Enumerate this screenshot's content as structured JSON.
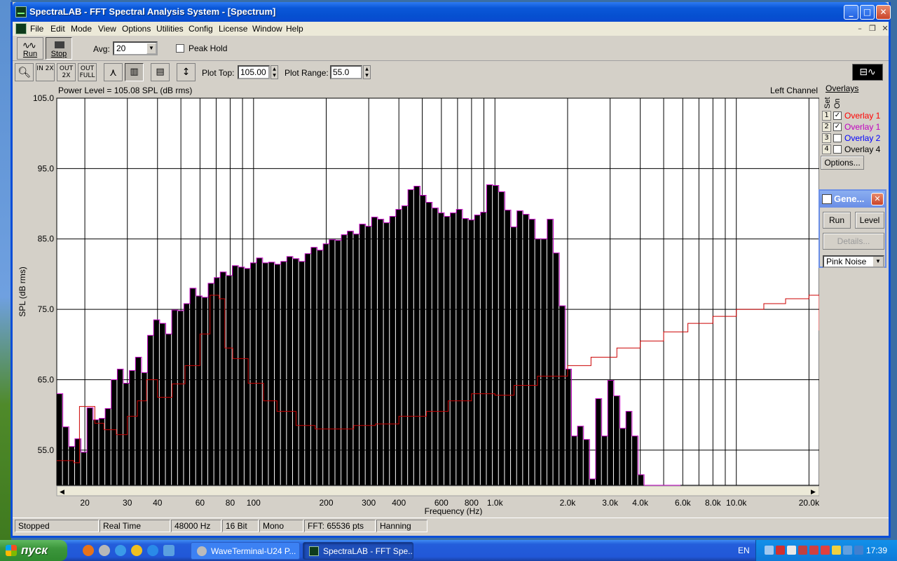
{
  "window": {
    "title": "SpectraLAB - FFT Spectral Analysis System - [Spectrum]"
  },
  "menu": [
    "File",
    "Edit",
    "Mode",
    "View",
    "Options",
    "Utilities",
    "Config",
    "License",
    "Window",
    "Help"
  ],
  "toolbar": {
    "run_label": "Run",
    "stop_label": "Stop",
    "avg_label": "Avg:",
    "avg_value": "20",
    "peak_hold_label": "Peak Hold",
    "peak_hold_checked": false,
    "zoom_in_label": "IN 2X",
    "zoom_out_label": "OUT 2X",
    "zoom_full_label": "OUT FULL",
    "plot_top_label": "Plot Top:",
    "plot_top_value": "105.00",
    "plot_range_label": "Plot Range:",
    "plot_range_value": "55.0"
  },
  "plot": {
    "power_level": "Power Level = 105.08 SPL (dB rms)",
    "channel": "Left Channel"
  },
  "overlays": {
    "header": "Overlays",
    "set_label": "Set",
    "on_label": "On",
    "items": [
      {
        "num": "1",
        "name": "Overlay 1",
        "checked": true,
        "color": "#ff0000"
      },
      {
        "num": "2",
        "name": "Overlay 1",
        "checked": true,
        "color": "#c000c0"
      },
      {
        "num": "3",
        "name": "Overlay 2",
        "checked": false,
        "color": "#0000ff"
      },
      {
        "num": "4",
        "name": "Overlay 4",
        "checked": false,
        "color": "#000000"
      }
    ],
    "options_label": "Options..."
  },
  "generator": {
    "title": "Gene...",
    "run_label": "Run",
    "level_label": "Level",
    "details_label": "Details...",
    "signal": "Pink Noise"
  },
  "status": [
    "Stopped",
    "Real Time",
    "48000 Hz",
    "16 Bit",
    "Mono",
    "FFT: 65536 pts",
    "Hanning"
  ],
  "taskbar": {
    "start_label": "пуск",
    "tasks": [
      "WaveTerminal-U24 P...",
      "SpectraLAB - FFT Spe..."
    ],
    "lang": "EN",
    "clock": "17:39"
  },
  "chart_data": {
    "type": "bar",
    "xlabel": "Frequency (Hz)",
    "ylabel": "SPL (dB rms)",
    "xscale": "log",
    "xlim": [
      15.3,
      22050
    ],
    "ylim": [
      50,
      105
    ],
    "yticks": [
      55.0,
      65.0,
      75.0,
      85.0,
      95.0,
      105.0
    ],
    "xtick_labels": [
      {
        "f": 20,
        "label": "20"
      },
      {
        "f": 30,
        "label": "30"
      },
      {
        "f": 40,
        "label": "40"
      },
      {
        "f": 60,
        "label": "60"
      },
      {
        "f": 80,
        "label": "80"
      },
      {
        "f": 100,
        "label": "100"
      },
      {
        "f": 200,
        "label": "200"
      },
      {
        "f": 300,
        "label": "300"
      },
      {
        "f": 400,
        "label": "400"
      },
      {
        "f": 600,
        "label": "600"
      },
      {
        "f": 800,
        "label": "800"
      },
      {
        "f": 1000,
        "label": "1.0k"
      },
      {
        "f": 2000,
        "label": "2.0k"
      },
      {
        "f": 3000,
        "label": "3.0k"
      },
      {
        "f": 4000,
        "label": "4.0k"
      },
      {
        "f": 6000,
        "label": "6.0k"
      },
      {
        "f": 8000,
        "label": "8.0k"
      },
      {
        "f": 10000,
        "label": "10.0k"
      },
      {
        "f": 20000,
        "label": "20.0k"
      }
    ],
    "grid_freqs": [
      20,
      30,
      40,
      50,
      60,
      70,
      80,
      90,
      100,
      200,
      300,
      400,
      500,
      600,
      700,
      800,
      900,
      1000,
      2000,
      3000,
      4000,
      5000,
      6000,
      7000,
      8000,
      9000,
      10000,
      20000
    ],
    "band_resolution": "1/12 octave",
    "bands_start_hz": 15.3,
    "bar_values": [
      63.0,
      58.3,
      55.5,
      56.6,
      54.7,
      61.0,
      59.3,
      59.5,
      60.9,
      65.0,
      66.5,
      64.5,
      66.3,
      68.2,
      66.0,
      71.3,
      73.5,
      73.0,
      71.5,
      74.9,
      74.8,
      75.8,
      78.0,
      76.9,
      76.7,
      78.7,
      79.5,
      80.3,
      79.8,
      81.2,
      81.0,
      80.8,
      81.6,
      82.3,
      81.6,
      81.7,
      81.4,
      81.8,
      82.5,
      82.2,
      81.8,
      82.9,
      83.8,
      83.4,
      84.3,
      84.9,
      84.8,
      85.6,
      86.1,
      85.7,
      87.1,
      86.8,
      88.1,
      87.8,
      87.3,
      88.2,
      89.2,
      89.7,
      92.0,
      92.5,
      91.2,
      90.2,
      89.4,
      88.7,
      88.2,
      88.7,
      89.2,
      87.9,
      87.7,
      88.4,
      88.8,
      92.7,
      92.6,
      91.7,
      89.1,
      86.7,
      89.0,
      88.5,
      87.8,
      85.0,
      85.0,
      87.8,
      83.0,
      75.5,
      66.5,
      57.0,
      58.4,
      56.5,
      50.9,
      62.3,
      57.0,
      64.9,
      62.7,
      58.1,
      60.5,
      57.0,
      51.5,
      50.0,
      50.0,
      50.0,
      50.0,
      50.0,
      50.0
    ],
    "series": [
      {
        "name": "Overlay 1",
        "color": "#cc0000",
        "points": [
          [
            15.3,
            53.5
          ],
          [
            18.0,
            53.2
          ],
          [
            19.0,
            61.2
          ],
          [
            22.0,
            58.8
          ],
          [
            24.0,
            57.9
          ],
          [
            27.0,
            57.2
          ],
          [
            30.0,
            59.8
          ],
          [
            33.0,
            62.0
          ],
          [
            36.0,
            65.0
          ],
          [
            40.0,
            62.5
          ],
          [
            46.0,
            64.4
          ],
          [
            52.0,
            67.0
          ],
          [
            60.0,
            71.5
          ],
          [
            66.0,
            77.0
          ],
          [
            72.0,
            76.5
          ],
          [
            76.0,
            69.5
          ],
          [
            82.0,
            68.0
          ],
          [
            95.0,
            64.5
          ],
          [
            110.0,
            62.0
          ],
          [
            125.0,
            60.5
          ],
          [
            150.0,
            58.5
          ],
          [
            180.0,
            58.0
          ],
          [
            220.0,
            58.0
          ],
          [
            260.0,
            58.5
          ],
          [
            320.0,
            58.7
          ],
          [
            400.0,
            59.8
          ],
          [
            520.0,
            60.5
          ],
          [
            640.0,
            62.0
          ],
          [
            800.0,
            63.0
          ],
          [
            1000.0,
            62.8
          ],
          [
            1200.0,
            64.2
          ],
          [
            1500.0,
            65.5
          ],
          [
            2000.0,
            67.0
          ],
          [
            2500.0,
            68.2
          ],
          [
            3200.0,
            69.5
          ],
          [
            4000.0,
            70.5
          ],
          [
            5000.0,
            71.8
          ],
          [
            6300.0,
            73.0
          ],
          [
            8000.0,
            74.0
          ],
          [
            10000.0,
            75.0
          ],
          [
            13000.0,
            75.8
          ],
          [
            16000.0,
            76.5
          ],
          [
            20000.0,
            77.0
          ],
          [
            22050.0,
            72.0
          ]
        ]
      },
      {
        "name": "Overlay 1",
        "color": "#c000c0"
      }
    ]
  }
}
